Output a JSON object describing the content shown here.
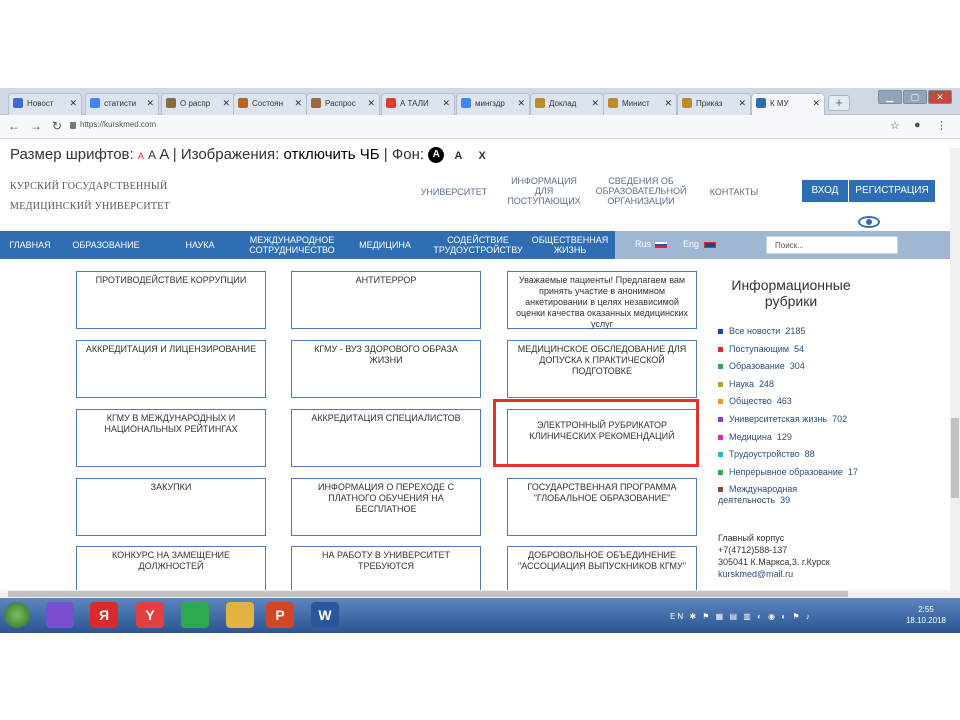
{
  "browser": {
    "tabs": [
      {
        "label": "Новост",
        "color": "#3b6ecf",
        "icon": "news-favicon"
      },
      {
        "label": "статисти",
        "color": "#4285f4",
        "icon": "google-favicon"
      },
      {
        "label": "О распр",
        "color": "#8a6d3b",
        "icon": "doc-favicon"
      },
      {
        "label": "Состоян",
        "color": "#b5651d",
        "icon": "doc-favicon"
      },
      {
        "label": "Распрос",
        "color": "#9c6a3a",
        "icon": "doc-favicon"
      },
      {
        "label": "А ТАЛИ",
        "color": "#d9412b",
        "icon": "ata-favicon"
      },
      {
        "label": "мингздр",
        "color": "#4285f4",
        "icon": "google-favicon"
      },
      {
        "label": "Доклад",
        "color": "#c08a2b",
        "icon": "emblem-favicon"
      },
      {
        "label": "Минист",
        "color": "#c08a2b",
        "icon": "emblem-favicon"
      },
      {
        "label": "Приказ",
        "color": "#c08a2b",
        "icon": "emblem-favicon"
      },
      {
        "label": "К МУ",
        "color": "#2f6eb5",
        "icon": "kgmu-favicon"
      }
    ],
    "url": "https://kurskmed.com"
  },
  "accessibility": {
    "font_size_label": "Размер шрифтов:",
    "a_small": "A",
    "a_medium": "A",
    "a_large": "A",
    "images_label": "Изображения:",
    "images_value": "отключить",
    "bw": "ЧБ",
    "bg_label": "Фон:",
    "bg_a_dark": "A",
    "bg_a_light": "A",
    "close": "X"
  },
  "header": {
    "logo_line1": "КУРСКИЙ ГОСУДАРСТВЕННЫЙ",
    "logo_line2": "МЕДИЦИНСКИЙ УНИВЕРСИТЕТ",
    "links": [
      {
        "label": "УНИВЕРСИТЕТ"
      },
      {
        "label": "ИНФОРМАЦИЯ ДЛЯ ПОСТУПАЮЩИХ"
      },
      {
        "label": "СВЕДЕНИЯ ОБ ОБРАЗОВАТЕЛЬНОЙ ОРГАНИЗАЦИИ"
      },
      {
        "label": "КОНТАКТЫ"
      }
    ],
    "login": "ВХОД",
    "register": "РЕГИСТРАЦИЯ"
  },
  "nav": {
    "items": [
      {
        "label": "ГЛАВНАЯ"
      },
      {
        "label": "ОБРАЗОВАНИЕ"
      },
      {
        "label": "НАУКА"
      },
      {
        "label": "МЕЖДУНАРОДНОЕ СОТРУДНИЧЕСТВО"
      },
      {
        "label": "МЕДИЦИНА"
      },
      {
        "label": "СОДЕЙСТВИЕ ТРУДОУСТРОЙСТВУ"
      },
      {
        "label": "ОБЩЕСТВЕННАЯ ЖИЗНЬ"
      }
    ],
    "lang_ru": "Rus",
    "lang_en": "Eng",
    "search_placeholder": "Поиск..."
  },
  "cards": {
    "col1": [
      "ПРОТИВОДЕЙСТВИЕ КОРРУПЦИИ",
      "АККРЕДИТАЦИЯ И ЛИЦЕНЗИРОВАНИЕ",
      "КГМУ В МЕЖДУНАРОДНЫХ И НАЦИОНАЛЬНЫХ РЕЙТИНГАХ",
      "ЗАКУПКИ",
      "КОНКУРС НА ЗАМЕЩЕНИЕ ДОЛЖНОСТЕЙ"
    ],
    "col2": [
      "АНТИТЕРРОР",
      "КГМУ - ВУЗ ЗДОРОВОГО ОБРАЗА ЖИЗНИ",
      "АККРЕДИТАЦИЯ СПЕЦИАЛИСТОВ",
      "ИНФОРМАЦИЯ О ПЕРЕХОДЕ С ПЛАТНОГО ОБУЧЕНИЯ НА БЕСПЛАТНОЕ",
      "НА РАБОТУ В УНИВЕРСИТЕТ ТРЕБУЮТСЯ"
    ],
    "col3": [
      "Уважаемые пациенты! Предлагаем вам принять участие в анонимном анкетировании в целях независимой оценки качества оказанных медицинских услуг",
      "МЕДИЦИНСКОЕ ОБСЛЕДОВАНИЕ ДЛЯ ДОПУСКА К ПРАКТИЧЕСКОЙ ПОДГОТОВКЕ",
      "ЭЛЕКТРОННЫЙ РУБРИКАТОР КЛИНИЧЕСКИХ РЕКОМЕНДАЦИЙ",
      "ГОСУДАРСТВЕННАЯ ПРОГРАММА \"ГЛОБАЛЬНОЕ ОБРАЗОВАНИЕ\"",
      "ДОБРОВОЛЬНОЕ ОБЪЕДИНЕНИЕ \"АССОЦИАЦИЯ ВЫПУСКНИКОВ КГМУ\""
    ]
  },
  "rubrics": {
    "title": "Информационные рубрики",
    "items": [
      {
        "label": "Все новости",
        "count": "2185",
        "color": "#1f3fbf"
      },
      {
        "label": "Поступающим",
        "count": "54",
        "color": "#d92b2b"
      },
      {
        "label": "Образование",
        "count": "304",
        "color": "#2fa84f"
      },
      {
        "label": "Наука",
        "count": "248",
        "color": "#9cb02a"
      },
      {
        "label": "Общество",
        "count": "463",
        "color": "#e0a020"
      },
      {
        "label": "Университетская жизнь",
        "count": "702",
        "color": "#8a3fbf"
      },
      {
        "label": "Медицина",
        "count": "129",
        "color": "#d62fb0"
      },
      {
        "label": "Трудоустройство",
        "count": "88",
        "color": "#22b8c8"
      },
      {
        "label": "Непрерывное образование",
        "count": "17",
        "color": "#2fa84f"
      },
      {
        "label": "Международная деятельность",
        "count": "39",
        "color": "#8a4a2a"
      }
    ]
  },
  "contacts": {
    "line1": "Главный корпус",
    "line2": "+7(4712)588-137",
    "line3": "305041 К.Маркса,3. г.Курск",
    "line4": "kurskmed@mail.ru"
  },
  "taskbar": {
    "apps": [
      {
        "label": "",
        "icon": "microphone-icon",
        "color": "#7a4fcf"
      },
      {
        "label": "Я",
        "icon": "yandex-icon",
        "color": "#d92b2b"
      },
      {
        "label": "Y",
        "icon": "yandex-browser-icon",
        "color": "#e04040"
      },
      {
        "label": "",
        "icon": "chrome-icon",
        "color": "#2fa84f"
      },
      {
        "label": "",
        "icon": "folder-icon",
        "color": "#e3b341"
      },
      {
        "label": "P",
        "icon": "powerpoint-icon",
        "color": "#d24726"
      },
      {
        "label": "W",
        "icon": "word-icon",
        "color": "#2b579a"
      }
    ],
    "lang": "EN",
    "time": "2:55",
    "date": "18.10.2018"
  }
}
